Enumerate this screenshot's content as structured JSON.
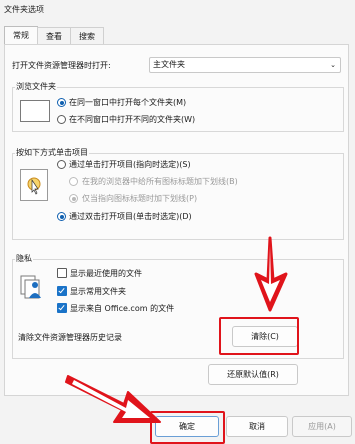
{
  "window": {
    "title": "文件夹选项"
  },
  "tabs": [
    {
      "label": "常规",
      "active": true
    },
    {
      "label": "查看",
      "active": false
    },
    {
      "label": "搜索",
      "active": false
    }
  ],
  "open_explorer": {
    "label": "打开文件资源管理器时打开:",
    "value": "主文件夹"
  },
  "browse_folders": {
    "title": "浏览文件夹",
    "options": [
      {
        "label": "在同一窗口中打开每个文件夹(M)",
        "selected": true
      },
      {
        "label": "在不同窗口中打开不同的文件夹(W)",
        "selected": false
      }
    ]
  },
  "click_items": {
    "title": "按如下方式单击项目",
    "single_click": {
      "label": "通过单击打开项目(指向时选定)(S)",
      "selected": false
    },
    "sub_options": [
      {
        "label": "在我的浏览器中给所有图标标题加下划线(B)",
        "enabled": false
      },
      {
        "label": "仅当指向图标标题时加下划线(P)",
        "enabled": false,
        "selected": true
      }
    ],
    "double_click": {
      "label": "通过双击打开项目(单击时选定)(D)",
      "selected": true
    }
  },
  "privacy": {
    "title": "隐私",
    "checkboxes": [
      {
        "label": "显示最近使用的文件",
        "checked": false
      },
      {
        "label": "显示常用文件夹",
        "checked": true
      },
      {
        "label": "显示来自 Office.com 的文件",
        "checked": true
      }
    ],
    "clear_label": "清除文件资源管理器历史记录",
    "clear_button": "清除(C)"
  },
  "restore_defaults": "还原默认值(R)",
  "footer": {
    "ok": "确定",
    "cancel": "取消",
    "apply": "应用(A)"
  },
  "annotation_color": "#e0141b",
  "accent_color": "#1a73c8"
}
